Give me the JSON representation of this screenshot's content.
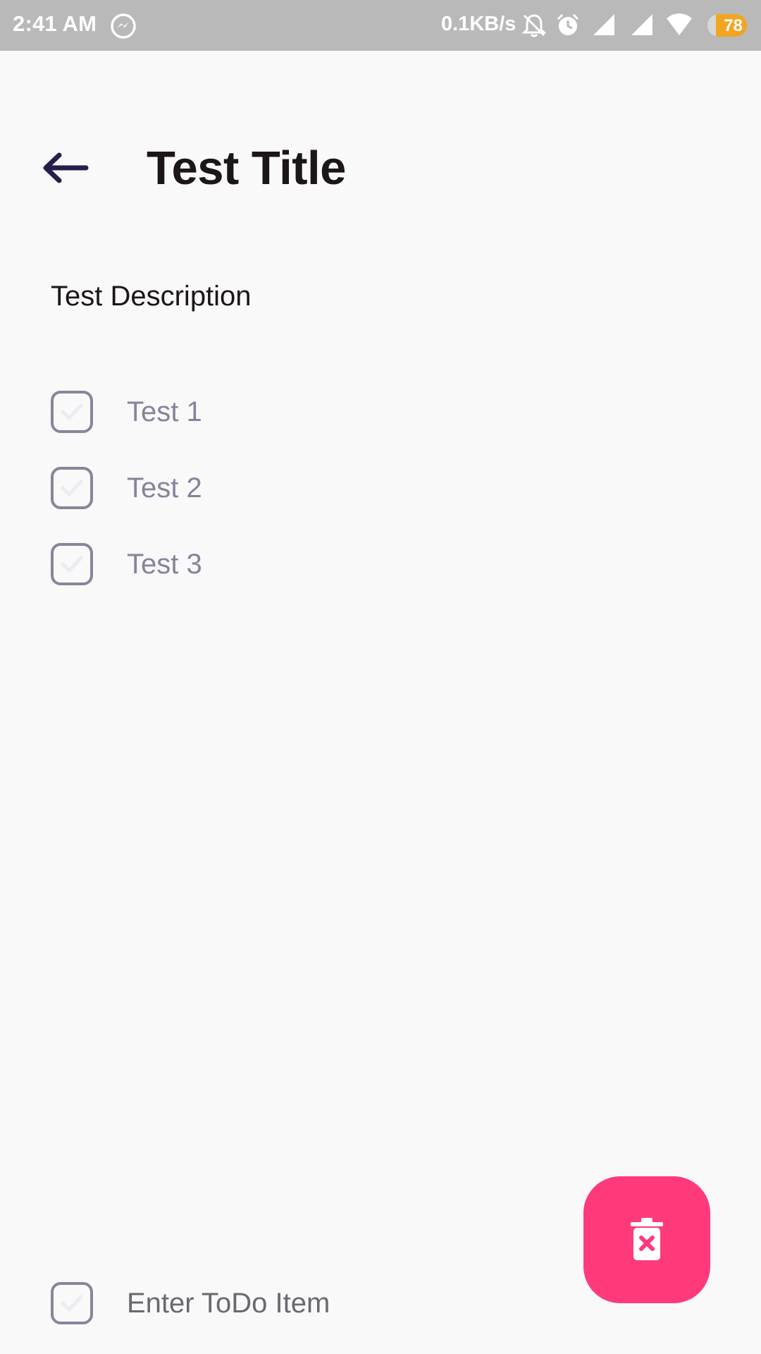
{
  "status_bar": {
    "time": "2:41 AM",
    "net_speed": "0.1KB/s",
    "battery_level": "78",
    "icons": [
      "messenger-icon",
      "mute-bell-icon",
      "alarm-icon",
      "signal-icon",
      "signal-icon",
      "wifi-icon",
      "battery-icon"
    ]
  },
  "header": {
    "back_icon": "arrow-left-icon",
    "title": "Test Title"
  },
  "description": "Test Description",
  "todos": [
    {
      "label": "Test 1",
      "checked": false
    },
    {
      "label": "Test 2",
      "checked": false
    },
    {
      "label": "Test 3",
      "checked": false
    }
  ],
  "new_item": {
    "placeholder": "Enter ToDo Item",
    "value": ""
  },
  "fab": {
    "icon": "delete-icon"
  },
  "colors": {
    "accent": "#ff3a7b",
    "checkbox_border": "#8a849c",
    "todo_text": "#86839a",
    "title_text": "#1c1616",
    "background": "#f9f9fa",
    "status_bar": "#b9b9b9",
    "battery": "#f2a521",
    "back_arrow": "#25204a"
  }
}
